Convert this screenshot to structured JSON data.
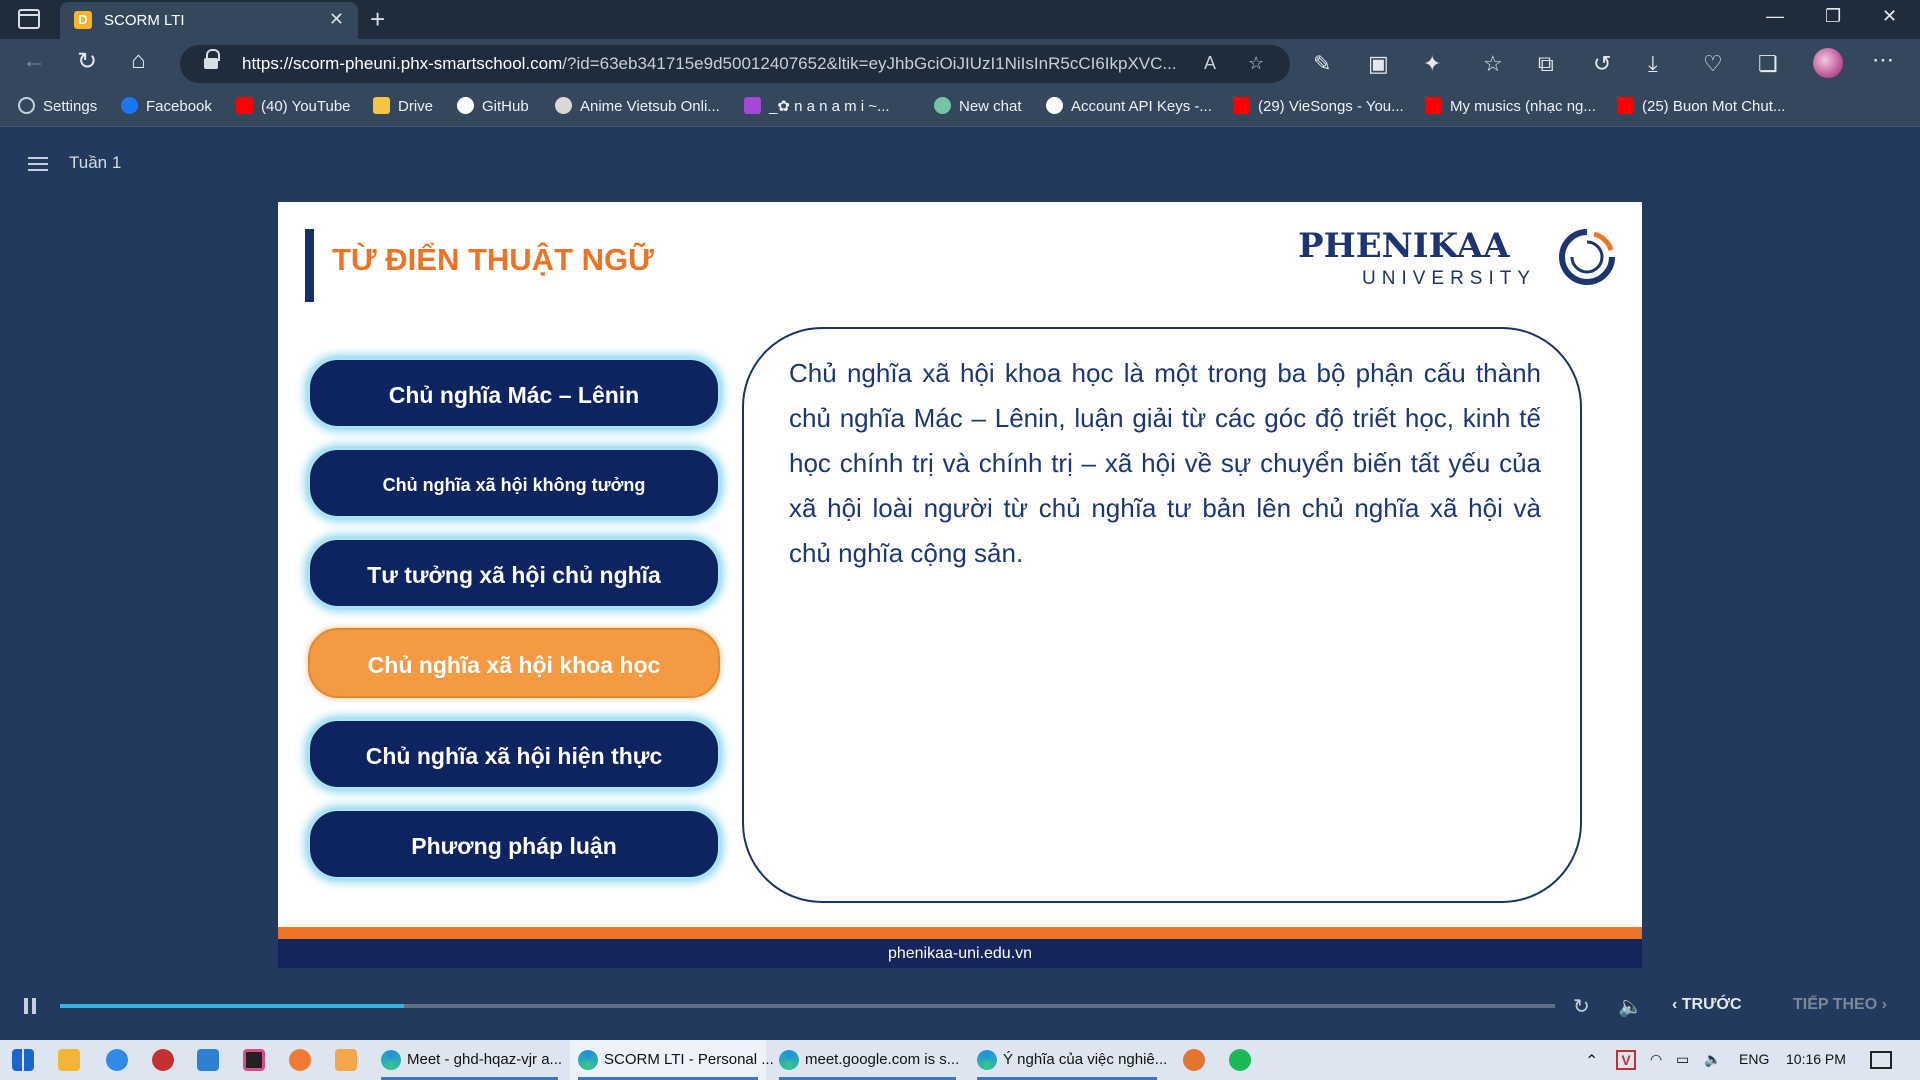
{
  "browser": {
    "tab_title": "SCORM LTI",
    "tab_favicon": "D",
    "url_host": "https://scorm-pheuni.phx-smartschool.com",
    "url_rest": "/?id=63eb341715e9d50012407652&ltik=eyJhbGciOiJIUzI1NiIsInR5cCI6IkpXVC..."
  },
  "bookmarks": [
    {
      "label": "Settings",
      "icon": "gear-icon",
      "color": "#c7d0da"
    },
    {
      "label": "Facebook",
      "icon": "facebook-icon",
      "color": "#1877f2"
    },
    {
      "label": "(40) YouTube",
      "icon": "youtube-icon",
      "color": "#ff0000"
    },
    {
      "label": "Drive",
      "icon": "folder-icon",
      "color": "#f5c542"
    },
    {
      "label": "GitHub",
      "icon": "github-icon",
      "color": "#ffffff"
    },
    {
      "label": "Anime Vietsub Onli...",
      "icon": "anime-icon",
      "color": "#d8d8d8"
    },
    {
      "label": "_✿ n a n a m i ~...",
      "icon": "nanami-icon",
      "color": "#a648d6"
    },
    {
      "label": "New chat",
      "icon": "chatgpt-icon",
      "color": "#74c5a5"
    },
    {
      "label": "Account API Keys -...",
      "icon": "openai-icon",
      "color": "#ffffff"
    },
    {
      "label": "(29) VieSongs - You...",
      "icon": "youtube-icon",
      "color": "#ff0000"
    },
    {
      "label": "My musics (nhạc ng...",
      "icon": "youtube-icon",
      "color": "#ff0000"
    },
    {
      "label": "(25) Buon Mot Chut...",
      "icon": "youtube-icon",
      "color": "#ff0000"
    }
  ],
  "page": {
    "week_title": "Tuần 1"
  },
  "slide": {
    "title": "TỪ ĐIỂN THUẬT NGỮ",
    "logo_word": "PHENIKAA",
    "logo_sub": "UNIVERSITY",
    "terms": [
      {
        "label": "Chủ nghĩa Mác – Lênin",
        "active": false
      },
      {
        "label": "Chủ nghĩa xã hội không tưởng",
        "active": false
      },
      {
        "label": "Tư tưởng xã hội chủ nghĩa",
        "active": false
      },
      {
        "label": "Chủ nghĩa xã hội khoa học",
        "active": true
      },
      {
        "label": "Chủ nghĩa xã hội hiện thực",
        "active": false
      },
      {
        "label": "Phương pháp luận",
        "active": false
      }
    ],
    "definition": "Chủ nghĩa xã hội khoa học là một trong ba bộ phận cấu thành chủ nghĩa Mác – Lênin, luận giải từ các góc độ triết học, kinh tế học chính trị và chính trị – xã hội về sự chuyển biến tất yếu của xã hội loài người từ chủ nghĩa tư bản lên chủ nghĩa xã hội và chủ nghĩa cộng sản.",
    "footer": "phenikaa-uni.edu.vn",
    "colors": {
      "accent": "#ee7425",
      "navy": "#0d2461",
      "active": "#f39a42"
    }
  },
  "player": {
    "progress": 0.23,
    "prev_label": "TRƯỚC",
    "next_label": "TIẾP THEO"
  },
  "taskbar": {
    "apps": [
      {
        "label": "Meet - ghd-hqaz-vjr a..."
      },
      {
        "label": "SCORM LTI - Personal ..."
      },
      {
        "label": "meet.google.com is s..."
      },
      {
        "label": "Ý nghĩa của việc nghiê..."
      }
    ],
    "lang": "ENG",
    "time": "10:16 PM"
  }
}
